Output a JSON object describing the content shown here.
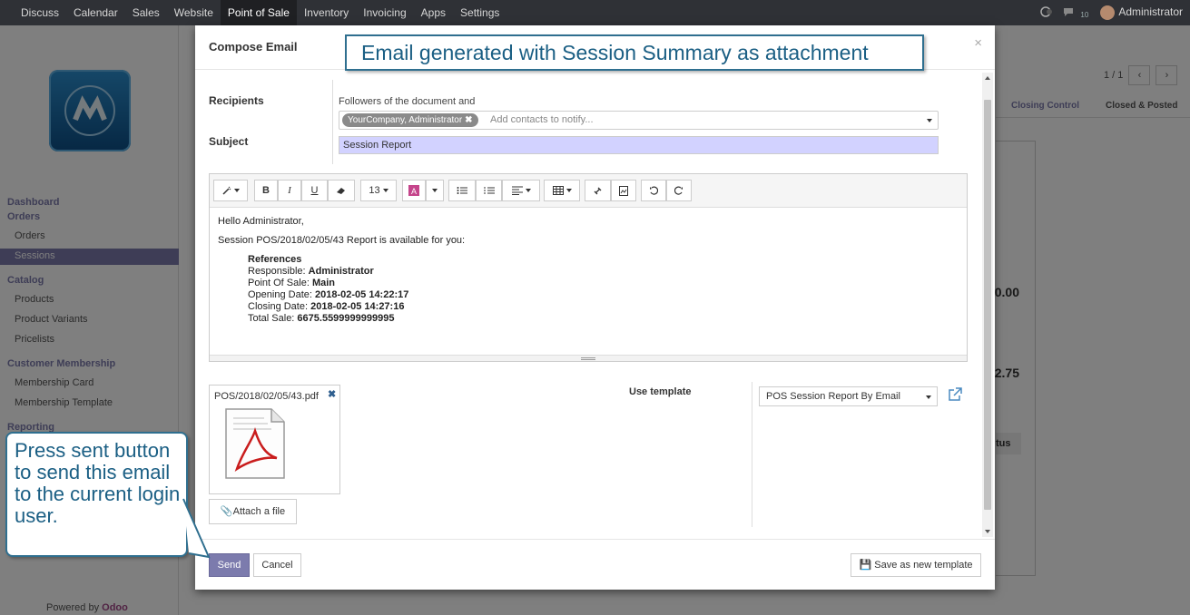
{
  "topbar": {
    "menu": [
      "Discuss",
      "Calendar",
      "Sales",
      "Website",
      "Point of Sale",
      "Inventory",
      "Invoicing",
      "Apps",
      "Settings"
    ],
    "active_index": 4,
    "messages_count": "10",
    "user": "Administrator"
  },
  "sidebar": {
    "sections": [
      {
        "title": "Dashboard"
      },
      {
        "title": "Orders",
        "items": [
          "Orders",
          "Sessions"
        ]
      },
      {
        "title": "Catalog",
        "items": [
          "Products",
          "Product Variants",
          "Pricelists"
        ]
      },
      {
        "title": "Customer Membership",
        "items": [
          "Membership Card",
          "Membership Template"
        ]
      },
      {
        "title": "Reporting"
      }
    ],
    "active_item": "Sessions",
    "powered_by": "Powered by",
    "powered_brand": "Odoo"
  },
  "background": {
    "pager": "1 / 1",
    "stages": [
      "Closing Control",
      "Closed & Posted"
    ],
    "amount1": "0.00",
    "amount2": "2.75",
    "status_label": "tus"
  },
  "modal": {
    "title": "Compose Email",
    "recipients_label": "Recipients",
    "followers_text": "Followers of the document and",
    "recipient_tag": "YourCompany, Administrator",
    "recipients_placeholder": "Add contacts to notify...",
    "subject_label": "Subject",
    "subject_value": "Session Report",
    "toolbar": {
      "font_size": "13"
    },
    "body": {
      "greeting": "Hello Administrator,",
      "intro": "Session POS/2018/02/05/43 Report is available for you:",
      "references_title": "References",
      "responsible_label": "Responsible: ",
      "responsible_value": "Administrator",
      "pos_label": "Point Of Sale: ",
      "pos_value": "Main",
      "opening_label": "Opening Date: ",
      "opening_value": "2018-02-05 14:22:17",
      "closing_label": "Closing Date: ",
      "closing_value": "2018-02-05 14:27:16",
      "total_label": "Total Sale: ",
      "total_value": "6675.5599999999995"
    },
    "attachment_name": "POS/2018/02/05/43.pdf",
    "attach_button": "Attach a file",
    "use_template_label": "Use template",
    "template_value": "POS Session Report By Email",
    "send_button": "Send",
    "cancel_button": "Cancel",
    "save_template_button": "Save as new template"
  },
  "annotations": {
    "top": "Email generated with Session Summary  as attachment",
    "left": "Press sent button to send this email to the current login user."
  },
  "colors": {
    "accent": "#7c7bad",
    "callout_text": "#1b5f84",
    "callout_border": "#2f6f8f",
    "subject_bg": "#d2d2ff"
  }
}
